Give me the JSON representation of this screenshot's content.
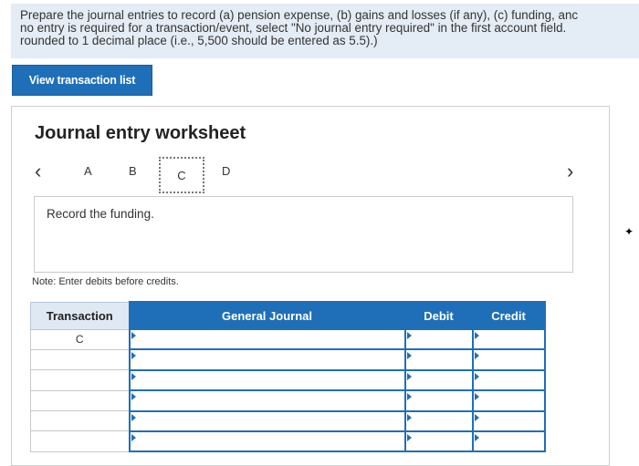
{
  "instructions": {
    "line1": "Prepare the journal entries to record (a) pension expense, (b) gains and losses (if any), (c) funding, anc",
    "line2": "no entry is required for a transaction/event, select \"No journal entry required\" in the first account field.",
    "line3": "rounded to 1 decimal place (i.e., 5,500 should be entered as 5.5).)"
  },
  "view_button": "View transaction list",
  "worksheet": {
    "title": "Journal entry worksheet",
    "pages": [
      "A",
      "B",
      "C",
      "D"
    ],
    "active_page": "C",
    "prompt": "Record the funding.",
    "note": "Note: Enter debits before credits."
  },
  "table": {
    "headers": {
      "transaction": "Transaction",
      "journal": "General Journal",
      "debit": "Debit",
      "credit": "Credit"
    },
    "rows": [
      {
        "transaction": "C",
        "account": "",
        "debit": "",
        "credit": ""
      },
      {
        "transaction": "",
        "account": "",
        "debit": "",
        "credit": ""
      },
      {
        "transaction": "",
        "account": "",
        "debit": "",
        "credit": ""
      },
      {
        "transaction": "",
        "account": "",
        "debit": "",
        "credit": ""
      },
      {
        "transaction": "",
        "account": "",
        "debit": "",
        "credit": ""
      },
      {
        "transaction": "",
        "account": "",
        "debit": "",
        "credit": ""
      }
    ]
  },
  "colors": {
    "accent": "#1f6fb8",
    "instruction_bg": "#e4ecf5"
  }
}
